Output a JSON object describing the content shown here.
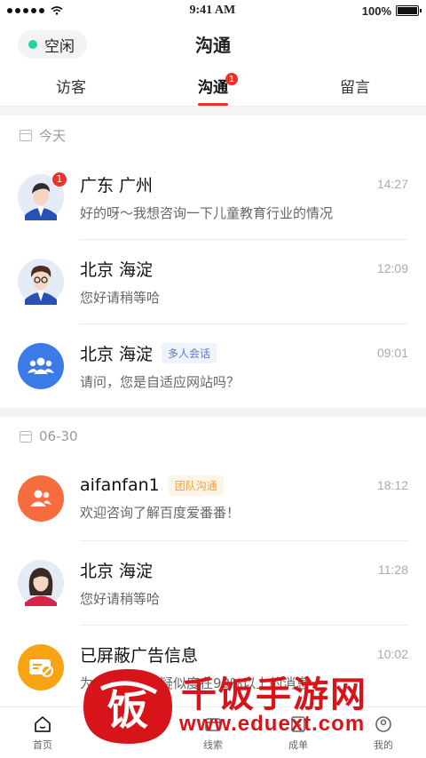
{
  "status_bar": {
    "time": "9:41 AM",
    "battery": "100%",
    "battery_level": 1.0
  },
  "header": {
    "status_label": "空闲",
    "title": "沟通"
  },
  "tabs": [
    {
      "label": "访客"
    },
    {
      "label": "沟通",
      "badge": "1"
    },
    {
      "label": "留言"
    }
  ],
  "sections": [
    {
      "date": "今天",
      "items": [
        {
          "name": "广东 广州",
          "time": "14:27",
          "message": "好的呀～我想咨询一下儿童教育行业的情况",
          "badge": "1",
          "avatar": "male-avatar-1"
        },
        {
          "name": "北京 海淀",
          "time": "12:09",
          "message": "您好请稍等哈",
          "avatar": "male-avatar-2"
        },
        {
          "name": "北京 海淀",
          "tag": "多人会话",
          "time": "09:01",
          "message": "请问，您是自适应网站吗？",
          "avatar": "group-icon"
        }
      ]
    },
    {
      "date": "06-30",
      "items": [
        {
          "name": "aifanfan1",
          "tag": "团队沟通",
          "time": "18:12",
          "message": "欢迎咨询了解百度爱番番！",
          "avatar": "team-icon"
        },
        {
          "name": "北京 海淀",
          "time": "11:28",
          "message": "您好请稍等哈",
          "avatar": "female-avatar"
        },
        {
          "name": "已屏蔽广告信息",
          "time": "10:02",
          "message": "为您屏蔽广告疑似度在90%以上的消息",
          "avatar": "blocked-ad-icon"
        }
      ]
    }
  ],
  "bottom_nav": [
    {
      "label": "首页",
      "icon": "home-icon"
    },
    {
      "label": "",
      "icon": "chat-icon"
    },
    {
      "label": "线索",
      "icon": "leads-icon"
    },
    {
      "label": "成单",
      "icon": "deal-icon"
    },
    {
      "label": "我的",
      "icon": "profile-icon"
    }
  ],
  "watermark": {
    "title": "千饭手游网",
    "url": "www.eduext.com",
    "logo_glyph": "饭"
  },
  "colors": {
    "accent": "#e8332a",
    "online": "#27d3a3",
    "group_blue": "#3b7be8",
    "team_orange": "#f56c3f",
    "ad_yellow": "#f7a414"
  }
}
